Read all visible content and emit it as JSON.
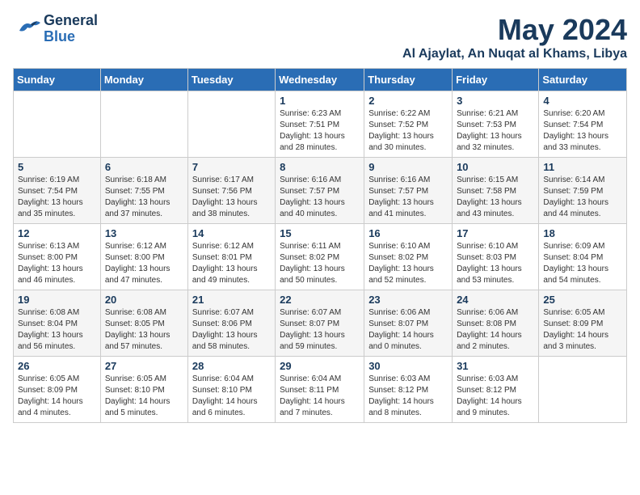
{
  "logo": {
    "general": "General",
    "blue": "Blue"
  },
  "title": "May 2024",
  "location": "Al Ajaylat, An Nuqat al Khams, Libya",
  "days_of_week": [
    "Sunday",
    "Monday",
    "Tuesday",
    "Wednesday",
    "Thursday",
    "Friday",
    "Saturday"
  ],
  "weeks": [
    [
      {
        "day": "",
        "info": ""
      },
      {
        "day": "",
        "info": ""
      },
      {
        "day": "",
        "info": ""
      },
      {
        "day": "1",
        "info": "Sunrise: 6:23 AM\nSunset: 7:51 PM\nDaylight: 13 hours and 28 minutes."
      },
      {
        "day": "2",
        "info": "Sunrise: 6:22 AM\nSunset: 7:52 PM\nDaylight: 13 hours and 30 minutes."
      },
      {
        "day": "3",
        "info": "Sunrise: 6:21 AM\nSunset: 7:53 PM\nDaylight: 13 hours and 32 minutes."
      },
      {
        "day": "4",
        "info": "Sunrise: 6:20 AM\nSunset: 7:54 PM\nDaylight: 13 hours and 33 minutes."
      }
    ],
    [
      {
        "day": "5",
        "info": "Sunrise: 6:19 AM\nSunset: 7:54 PM\nDaylight: 13 hours and 35 minutes."
      },
      {
        "day": "6",
        "info": "Sunrise: 6:18 AM\nSunset: 7:55 PM\nDaylight: 13 hours and 37 minutes."
      },
      {
        "day": "7",
        "info": "Sunrise: 6:17 AM\nSunset: 7:56 PM\nDaylight: 13 hours and 38 minutes."
      },
      {
        "day": "8",
        "info": "Sunrise: 6:16 AM\nSunset: 7:57 PM\nDaylight: 13 hours and 40 minutes."
      },
      {
        "day": "9",
        "info": "Sunrise: 6:16 AM\nSunset: 7:57 PM\nDaylight: 13 hours and 41 minutes."
      },
      {
        "day": "10",
        "info": "Sunrise: 6:15 AM\nSunset: 7:58 PM\nDaylight: 13 hours and 43 minutes."
      },
      {
        "day": "11",
        "info": "Sunrise: 6:14 AM\nSunset: 7:59 PM\nDaylight: 13 hours and 44 minutes."
      }
    ],
    [
      {
        "day": "12",
        "info": "Sunrise: 6:13 AM\nSunset: 8:00 PM\nDaylight: 13 hours and 46 minutes."
      },
      {
        "day": "13",
        "info": "Sunrise: 6:12 AM\nSunset: 8:00 PM\nDaylight: 13 hours and 47 minutes."
      },
      {
        "day": "14",
        "info": "Sunrise: 6:12 AM\nSunset: 8:01 PM\nDaylight: 13 hours and 49 minutes."
      },
      {
        "day": "15",
        "info": "Sunrise: 6:11 AM\nSunset: 8:02 PM\nDaylight: 13 hours and 50 minutes."
      },
      {
        "day": "16",
        "info": "Sunrise: 6:10 AM\nSunset: 8:02 PM\nDaylight: 13 hours and 52 minutes."
      },
      {
        "day": "17",
        "info": "Sunrise: 6:10 AM\nSunset: 8:03 PM\nDaylight: 13 hours and 53 minutes."
      },
      {
        "day": "18",
        "info": "Sunrise: 6:09 AM\nSunset: 8:04 PM\nDaylight: 13 hours and 54 minutes."
      }
    ],
    [
      {
        "day": "19",
        "info": "Sunrise: 6:08 AM\nSunset: 8:04 PM\nDaylight: 13 hours and 56 minutes."
      },
      {
        "day": "20",
        "info": "Sunrise: 6:08 AM\nSunset: 8:05 PM\nDaylight: 13 hours and 57 minutes."
      },
      {
        "day": "21",
        "info": "Sunrise: 6:07 AM\nSunset: 8:06 PM\nDaylight: 13 hours and 58 minutes."
      },
      {
        "day": "22",
        "info": "Sunrise: 6:07 AM\nSunset: 8:07 PM\nDaylight: 13 hours and 59 minutes."
      },
      {
        "day": "23",
        "info": "Sunrise: 6:06 AM\nSunset: 8:07 PM\nDaylight: 14 hours and 0 minutes."
      },
      {
        "day": "24",
        "info": "Sunrise: 6:06 AM\nSunset: 8:08 PM\nDaylight: 14 hours and 2 minutes."
      },
      {
        "day": "25",
        "info": "Sunrise: 6:05 AM\nSunset: 8:09 PM\nDaylight: 14 hours and 3 minutes."
      }
    ],
    [
      {
        "day": "26",
        "info": "Sunrise: 6:05 AM\nSunset: 8:09 PM\nDaylight: 14 hours and 4 minutes."
      },
      {
        "day": "27",
        "info": "Sunrise: 6:05 AM\nSunset: 8:10 PM\nDaylight: 14 hours and 5 minutes."
      },
      {
        "day": "28",
        "info": "Sunrise: 6:04 AM\nSunset: 8:10 PM\nDaylight: 14 hours and 6 minutes."
      },
      {
        "day": "29",
        "info": "Sunrise: 6:04 AM\nSunset: 8:11 PM\nDaylight: 14 hours and 7 minutes."
      },
      {
        "day": "30",
        "info": "Sunrise: 6:03 AM\nSunset: 8:12 PM\nDaylight: 14 hours and 8 minutes."
      },
      {
        "day": "31",
        "info": "Sunrise: 6:03 AM\nSunset: 8:12 PM\nDaylight: 14 hours and 9 minutes."
      },
      {
        "day": "",
        "info": ""
      }
    ]
  ]
}
